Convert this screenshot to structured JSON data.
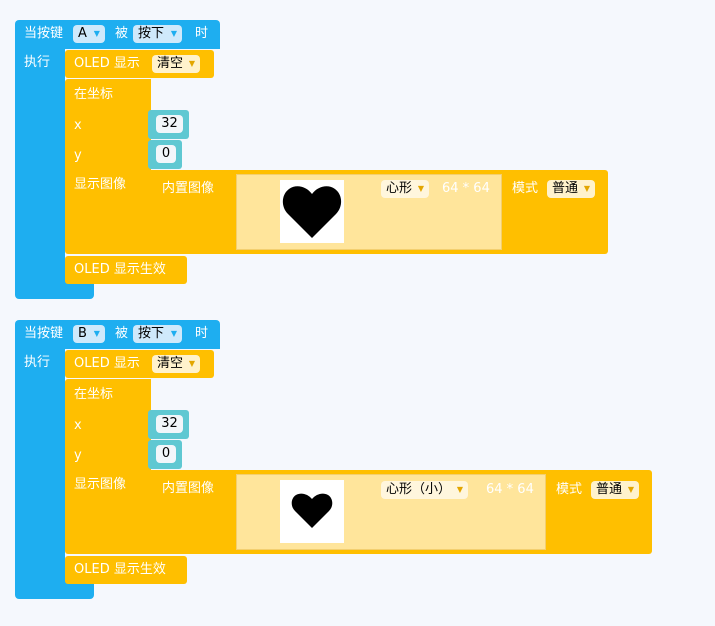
{
  "blocks": [
    {
      "event": {
        "prefix": "当按键",
        "key": "A",
        "mid": "被",
        "action": "按下",
        "suffix": "时"
      },
      "do_label": "执行",
      "oled_show": {
        "label": "OLED 显示",
        "mode": "清空"
      },
      "at_coord": "在坐标",
      "x": {
        "label": "x",
        "value": "32"
      },
      "y": {
        "label": "y",
        "value": "0"
      },
      "show_image": "显示图像",
      "builtin_image": "内置图像",
      "image": {
        "name": "心形",
        "size": "64 * 64",
        "icon": "heart-large"
      },
      "mode": {
        "label": "模式",
        "value": "普通"
      },
      "oled_apply": "OLED 显示生效"
    },
    {
      "event": {
        "prefix": "当按键",
        "key": "B",
        "mid": "被",
        "action": "按下",
        "suffix": "时"
      },
      "do_label": "执行",
      "oled_show": {
        "label": "OLED 显示",
        "mode": "清空"
      },
      "at_coord": "在坐标",
      "x": {
        "label": "x",
        "value": "32"
      },
      "y": {
        "label": "y",
        "value": "0"
      },
      "show_image": "显示图像",
      "builtin_image": "内置图像",
      "image": {
        "name": "心形（小）",
        "size": "64 * 64",
        "icon": "heart-small"
      },
      "mode": {
        "label": "模式",
        "value": "普通"
      },
      "oled_apply": "OLED 显示生效"
    }
  ],
  "colors": {
    "event_block": "#1eaef0",
    "display_block": "#ffbf00",
    "number_block": "#5fc8d2",
    "canvas": "#f5f8fd"
  }
}
